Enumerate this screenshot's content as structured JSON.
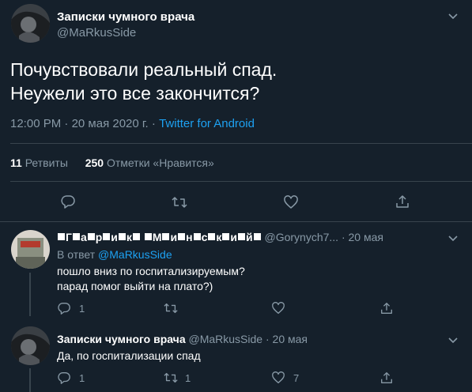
{
  "main_tweet": {
    "display_name": "Записки чумного врача",
    "handle": "@MaRkusSide",
    "text_line1": "Почувствовали реальный спад.",
    "text_line2": "Неужели это все закончится?",
    "time": "12:00 PM",
    "date": "20 мая 2020 г.",
    "source": "Twitter for Android",
    "retweets_count": "11",
    "retweets_label": "Ретвиты",
    "likes_count": "250",
    "likes_label": "Отметки «Нравится»"
  },
  "reply1": {
    "name_parts": [
      "Г",
      "а",
      "р",
      "и",
      "к",
      "М",
      "и",
      "н",
      "с",
      "к",
      "и",
      "й"
    ],
    "handle": "@Gorynych7...",
    "date": "20 мая",
    "reply_to_label": "В ответ",
    "reply_to_handle": "@MaRkusSide",
    "text_line1": "пошло вниз по госпитализируемым?",
    "text_line2": "парад помог выйти на плато?)",
    "reply_count": "1"
  },
  "reply2": {
    "display_name": "Записки чумного врача",
    "handle": "@MaRkusSide",
    "date": "20 мая",
    "text": "Да, по госпитализации спад",
    "reply_count": "1",
    "retweet_count": "1",
    "like_count": "7"
  },
  "icons": [
    "chevron-down-icon",
    "reply-icon",
    "retweet-icon",
    "like-icon",
    "share-icon"
  ],
  "colors": {
    "background": "#15202b",
    "muted": "#8899a6",
    "link": "#1da1f2",
    "divider": "#38444d"
  }
}
